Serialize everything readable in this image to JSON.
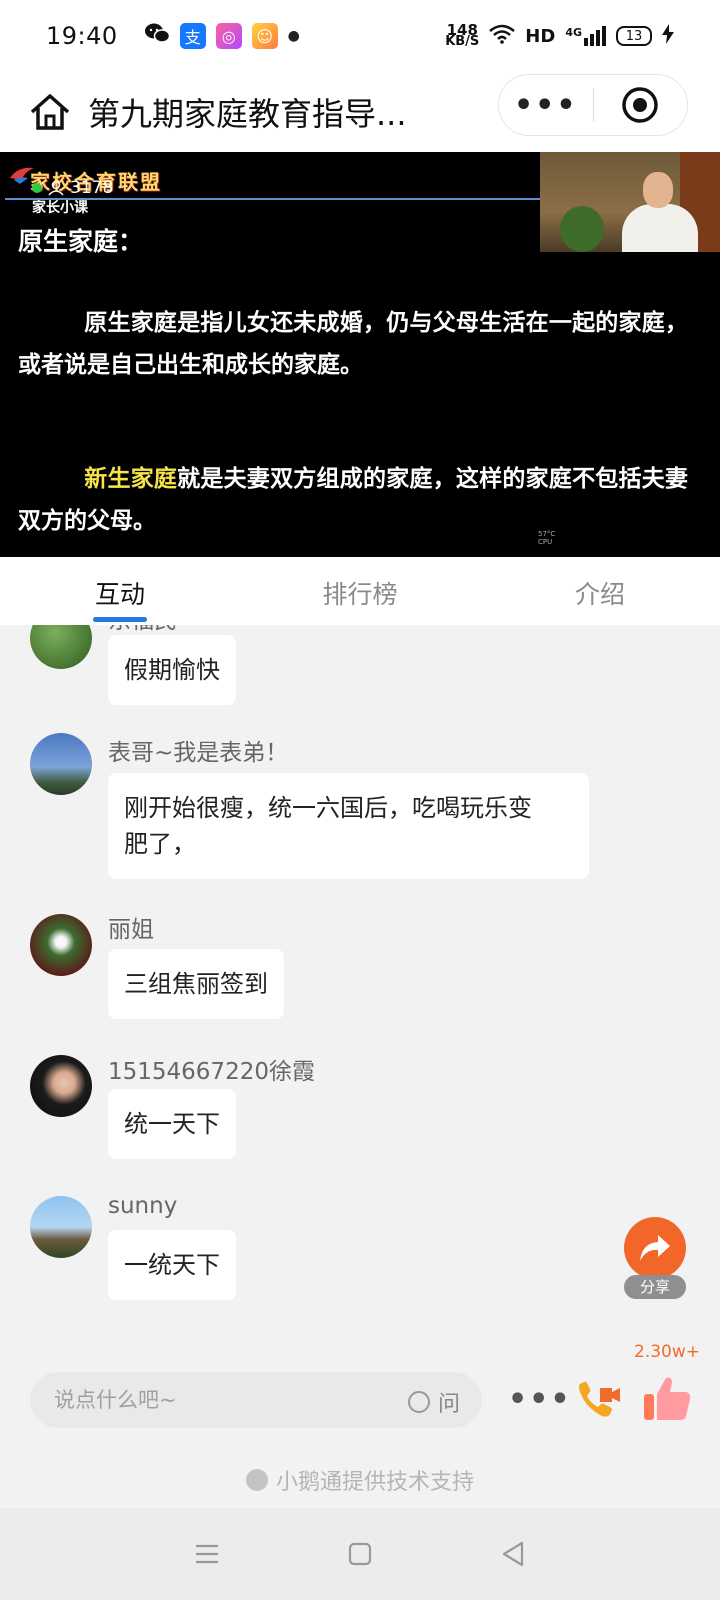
{
  "status_bar": {
    "time": "19:40",
    "net_speed_value": "148",
    "net_speed_unit": "KB/S",
    "hd": "HD",
    "network": "4G",
    "battery": "13",
    "app_icons": [
      "wechat-icon",
      "alipay-icon",
      "app-icon",
      "game-icon"
    ]
  },
  "nav": {
    "title": "第九期家庭教育指导...",
    "more_label": "•••"
  },
  "video": {
    "logo_text": "家校合育联盟",
    "sub_logo": "家长小课",
    "online_count": "3178",
    "heading": "原生家庭：",
    "paragraph1": "原生家庭是指儿女还未成婚，仍与父母生活在一起的家庭，或者说是自己出生和成长的家庭。",
    "highlight": "新生家庭",
    "paragraph2_rest": "就是夫妻双方组成的家庭，这样的家庭不包括夫妻双方的父母。",
    "cpu_line1": "57°C",
    "cpu_line2": "CPU"
  },
  "tabs": [
    {
      "label": "互动",
      "active": true
    },
    {
      "label": "排行榜",
      "active": false
    },
    {
      "label": "介绍",
      "active": false
    }
  ],
  "messages": [
    {
      "name": "东福民",
      "text": "假期愉快"
    },
    {
      "name": "表哥~我是表弟！",
      "text_line1": "刚开始很瘦，统一六国后，吃喝玩乐变",
      "text_line2": "肥了，"
    },
    {
      "name": "丽姐",
      "text": "三组焦丽签到"
    },
    {
      "name": "15154667220徐霞",
      "text": "统一天下"
    },
    {
      "name": "sunny",
      "text": "一统天下"
    }
  ],
  "share": {
    "label": "分享"
  },
  "bottom": {
    "input_placeholder": "说点什么吧~",
    "ask_label": "问",
    "more_label": "•••",
    "like_count": "2.30w+"
  },
  "support_text": "小鹅通提供技术支持",
  "colors": {
    "accent_blue": "#1e7be6",
    "share_orange": "#f2662a",
    "like_orange": "#f26b2a",
    "video_highlight": "#f6e34a"
  }
}
